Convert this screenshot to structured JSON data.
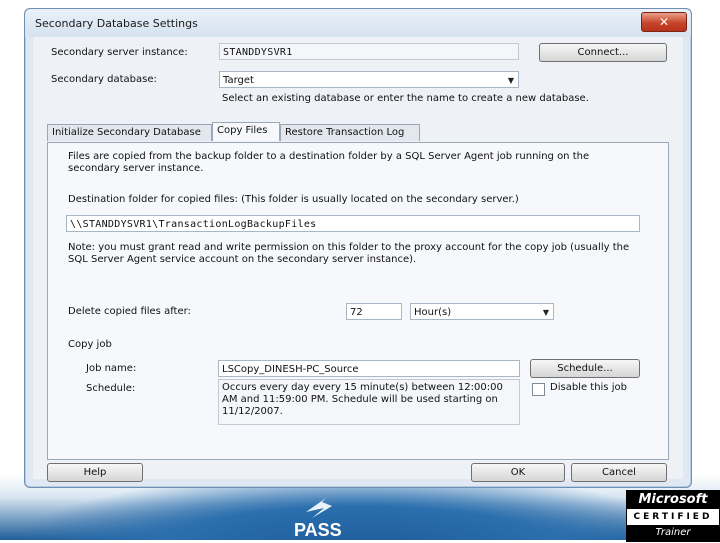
{
  "window": {
    "title": "Secondary Database Settings",
    "close_glyph": "✕"
  },
  "server": {
    "instance_label": "Secondary server instance:",
    "instance_value": "STANDDYSVR1",
    "connect_label": "Connect...",
    "database_label": "Secondary database:",
    "database_value": "Target",
    "database_hint": "Select an existing database or enter the name to create a new database."
  },
  "tabs": [
    {
      "label": "Initialize Secondary Database"
    },
    {
      "label": "Copy Files"
    },
    {
      "label": "Restore Transaction Log"
    }
  ],
  "copy_files": {
    "intro": "Files are copied from the backup folder to a destination folder by a SQL Server Agent job running on the secondary server instance.",
    "dest_label": "Destination folder for copied files: (This folder is usually located on the secondary server.)",
    "dest_value": "\\\\STANDDYSVR1\\TransactionLogBackupFiles",
    "note": "Note: you must grant read and write permission on this folder to the proxy account for the copy job (usually the SQL Server Agent service account on the secondary server instance).",
    "delete_label": "Delete copied files after:",
    "delete_value": "72",
    "delete_unit": "Hour(s)",
    "group_label": "Copy job",
    "job_name_label": "Job name:",
    "job_name_value": "LSCopy_DINESH-PC_Source",
    "schedule_button": "Schedule...",
    "schedule_label": "Schedule:",
    "schedule_text": "Occurs every day every 15 minute(s) between 12:00:00 AM and 11:59:00 PM. Schedule will be used starting on 11/12/2007.",
    "disable_label": "Disable this job",
    "disable_checked": false
  },
  "footer": {
    "help": "Help",
    "ok": "OK",
    "cancel": "Cancel"
  },
  "logos": {
    "pass": "PASS",
    "ms_top": "Microsoft",
    "ms_mid": "CERTIFIED",
    "ms_bot": "Trainer"
  },
  "colors": {
    "accent": "#1f5e99",
    "dialog": "#dfe8f3",
    "close": "#c7452a"
  }
}
